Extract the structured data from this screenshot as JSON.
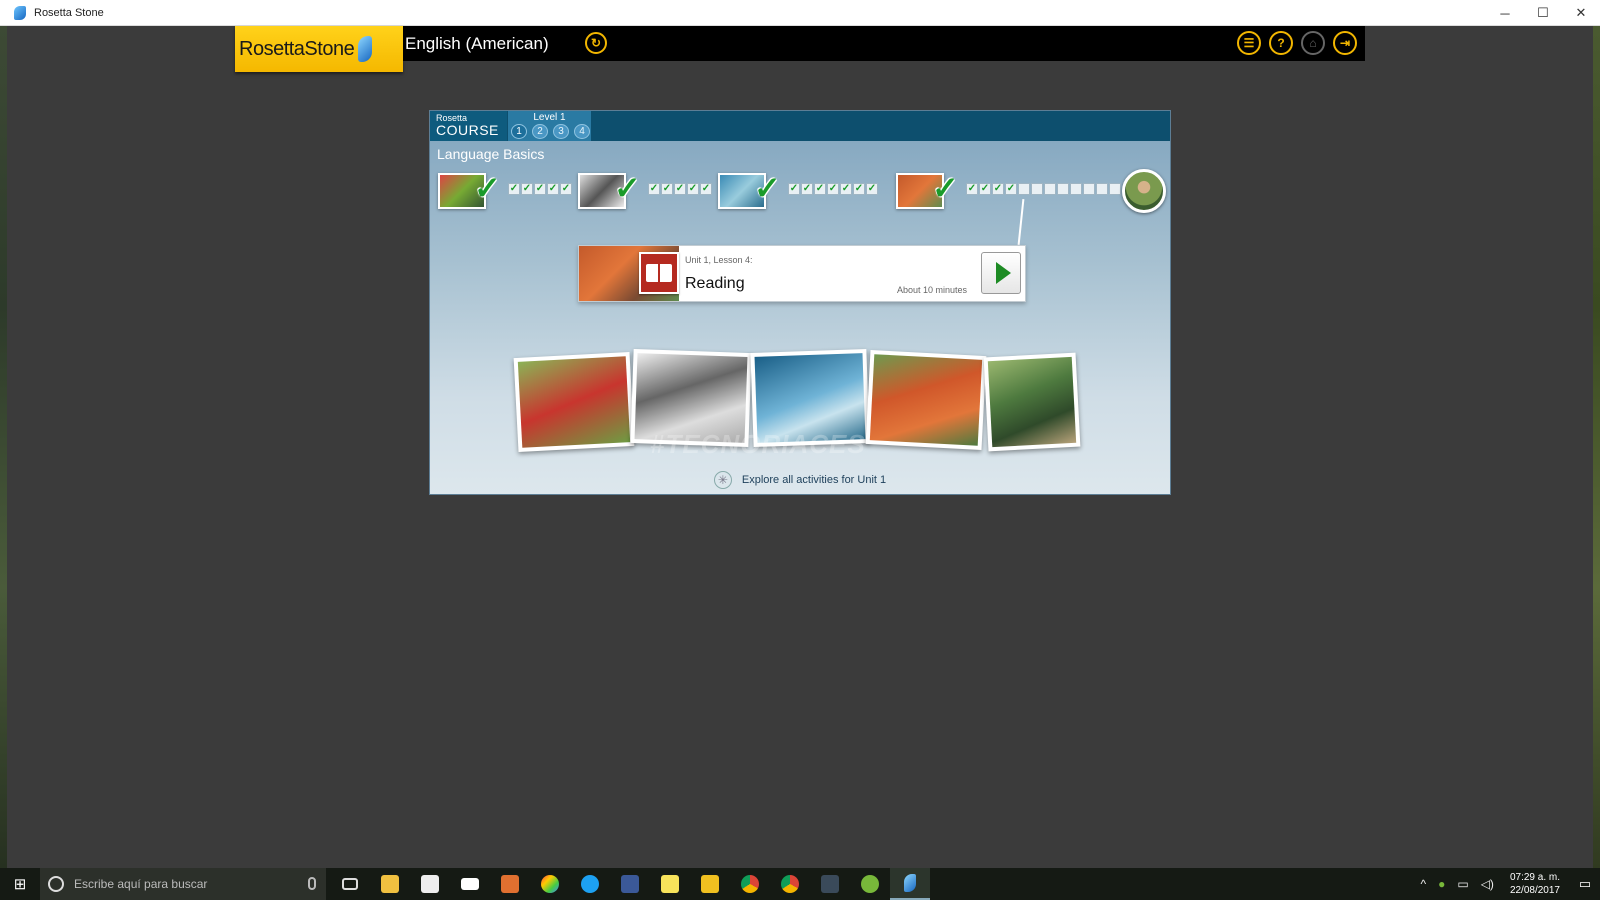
{
  "window": {
    "title": "Rosetta Stone",
    "controls": [
      "─",
      "☐",
      "✕"
    ]
  },
  "header": {
    "logo": "RosettaStone",
    "language": "English (American)",
    "switch_icon": "↻",
    "icons": [
      {
        "name": "menu-dropdown-icon",
        "glyph": "☰"
      },
      {
        "name": "help-icon",
        "glyph": "?"
      },
      {
        "name": "home-icon",
        "glyph": "⌂"
      },
      {
        "name": "exit-icon",
        "glyph": "⇥"
      }
    ]
  },
  "course": {
    "logo_small": "Rosetta",
    "logo_big": "COURSE",
    "level_label": "Level 1",
    "levels": [
      "1",
      "2",
      "3",
      "4"
    ],
    "section_title": "Language Basics",
    "check_glyph": "✓"
  },
  "lesson": {
    "subtitle": "Unit 1, Lesson 4:",
    "name": "Reading",
    "duration": "About 10 minutes"
  },
  "explore": {
    "text": "Explore all activities for Unit 1",
    "icon": "✳"
  },
  "watermark": "#TECNORIACES",
  "taskbar": {
    "search_placeholder": "Escribe aquí para buscar",
    "time": "07:29 a. m.",
    "date": "22/08/2017",
    "tray_chevron": "^"
  },
  "colors": {
    "accent": "#f2b600",
    "course_bar": "#0d4f6e",
    "check_green": "#1a9b2a"
  }
}
